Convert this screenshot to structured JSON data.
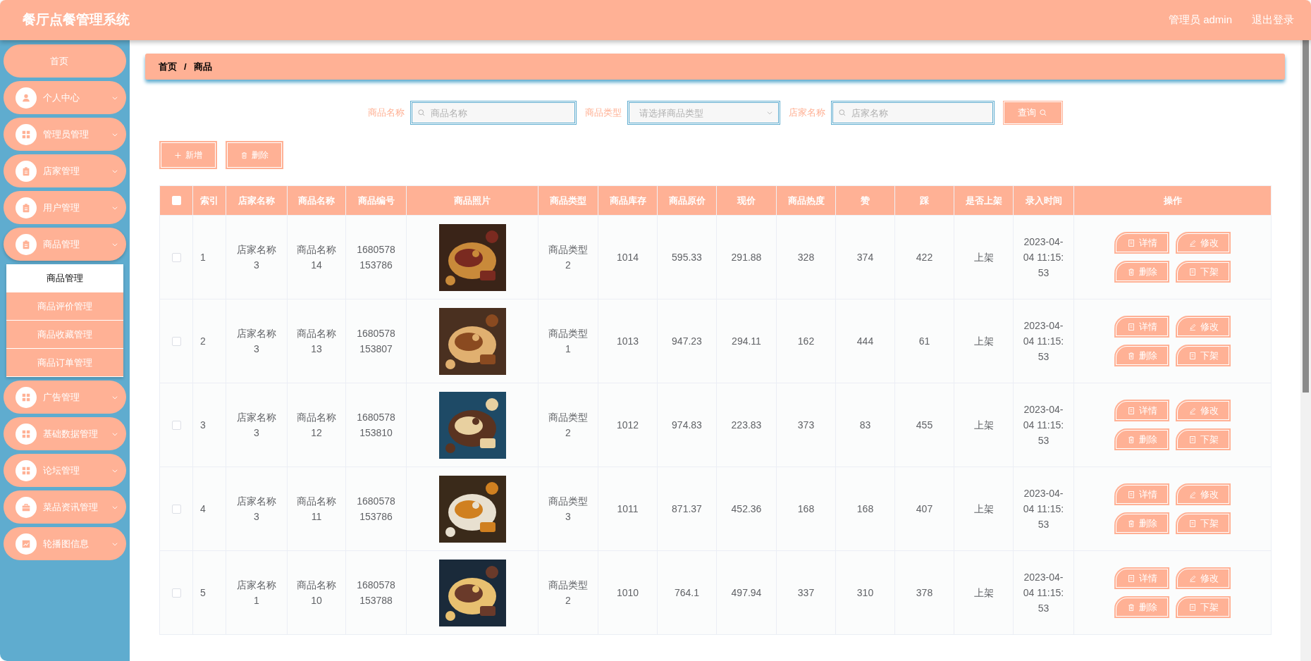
{
  "header": {
    "title": "餐厅点餐管理系统",
    "user": "管理员 admin",
    "logout": "退出登录"
  },
  "sidebar": {
    "items": [
      {
        "label": "首页",
        "expanded": false
      },
      {
        "label": "个人中心",
        "expanded": false
      },
      {
        "label": "管理员管理",
        "expanded": false
      },
      {
        "label": "店家管理",
        "expanded": false
      },
      {
        "label": "用户管理",
        "expanded": false
      },
      {
        "label": "商品管理",
        "expanded": true,
        "children": [
          {
            "label": "商品管理",
            "selected": true
          },
          {
            "label": "商品评价管理",
            "selected": false
          },
          {
            "label": "商品收藏管理",
            "selected": false
          },
          {
            "label": "商品订单管理",
            "selected": false
          }
        ]
      },
      {
        "label": "广告管理",
        "expanded": false
      },
      {
        "label": "基础数据管理",
        "expanded": false
      },
      {
        "label": "论坛管理",
        "expanded": false
      },
      {
        "label": "菜品资讯管理",
        "expanded": false
      },
      {
        "label": "轮播图信息",
        "expanded": false
      }
    ]
  },
  "breadcrumb": {
    "items": [
      "首页",
      "商品"
    ],
    "separator": "/"
  },
  "search": {
    "fields": [
      {
        "label": "商品名称",
        "kind": "input",
        "placeholder": "商品名称"
      },
      {
        "label": "商品类型",
        "kind": "select",
        "placeholder": "请选择商品类型"
      },
      {
        "label": "店家名称",
        "kind": "input",
        "placeholder": "店家名称"
      }
    ],
    "button": "查询"
  },
  "actions": [
    "新增",
    "删除"
  ],
  "table": {
    "select_all_checked": false,
    "columns": [
      "索引",
      "店家名称",
      "商品名称",
      "商品编号",
      "商品照片",
      "商品类型",
      "商品库存",
      "商品原价",
      "现价",
      "商品热度",
      "赞",
      "踩",
      "是否上架",
      "录入时间",
      "操作"
    ],
    "rows": [
      {
        "checked": false,
        "cells": [
          "1",
          "店家名称3",
          "商品名称14",
          "1680578153786",
          "",
          "商品类型2",
          "1014",
          "595.33",
          "291.88",
          "328",
          "374",
          "422",
          "上架",
          "2023-04-04 11:15:53"
        ],
        "buttons": [
          "详情",
          "修改",
          "删除",
          "下架"
        ]
      },
      {
        "checked": false,
        "cells": [
          "2",
          "店家名称3",
          "商品名称13",
          "1680578153807",
          "",
          "商品类型1",
          "1013",
          "947.23",
          "294.11",
          "162",
          "444",
          "61",
          "上架",
          "2023-04-04 11:15:53"
        ],
        "buttons": [
          "详情",
          "修改",
          "删除",
          "下架"
        ]
      },
      {
        "checked": false,
        "cells": [
          "3",
          "店家名称3",
          "商品名称12",
          "1680578153810",
          "",
          "商品类型2",
          "1012",
          "974.83",
          "223.83",
          "373",
          "83",
          "455",
          "上架",
          "2023-04-04 11:15:53"
        ],
        "buttons": [
          "详情",
          "修改",
          "删除",
          "下架"
        ]
      },
      {
        "checked": false,
        "cells": [
          "4",
          "店家名称3",
          "商品名称11",
          "1680578153786",
          "",
          "商品类型3",
          "1011",
          "871.37",
          "452.36",
          "168",
          "168",
          "407",
          "上架",
          "2023-04-04 11:15:53"
        ],
        "buttons": [
          "详情",
          "修改",
          "删除",
          "下架"
        ]
      },
      {
        "checked": false,
        "cells": [
          "5",
          "店家名称1",
          "商品名称10",
          "1680578153788",
          "",
          "商品类型2",
          "1010",
          "764.1",
          "497.94",
          "337",
          "310",
          "378",
          "上架",
          "2023-04-04 11:15:53"
        ],
        "buttons": [
          "详情",
          "修改",
          "删除",
          "下架"
        ]
      }
    ]
  }
}
